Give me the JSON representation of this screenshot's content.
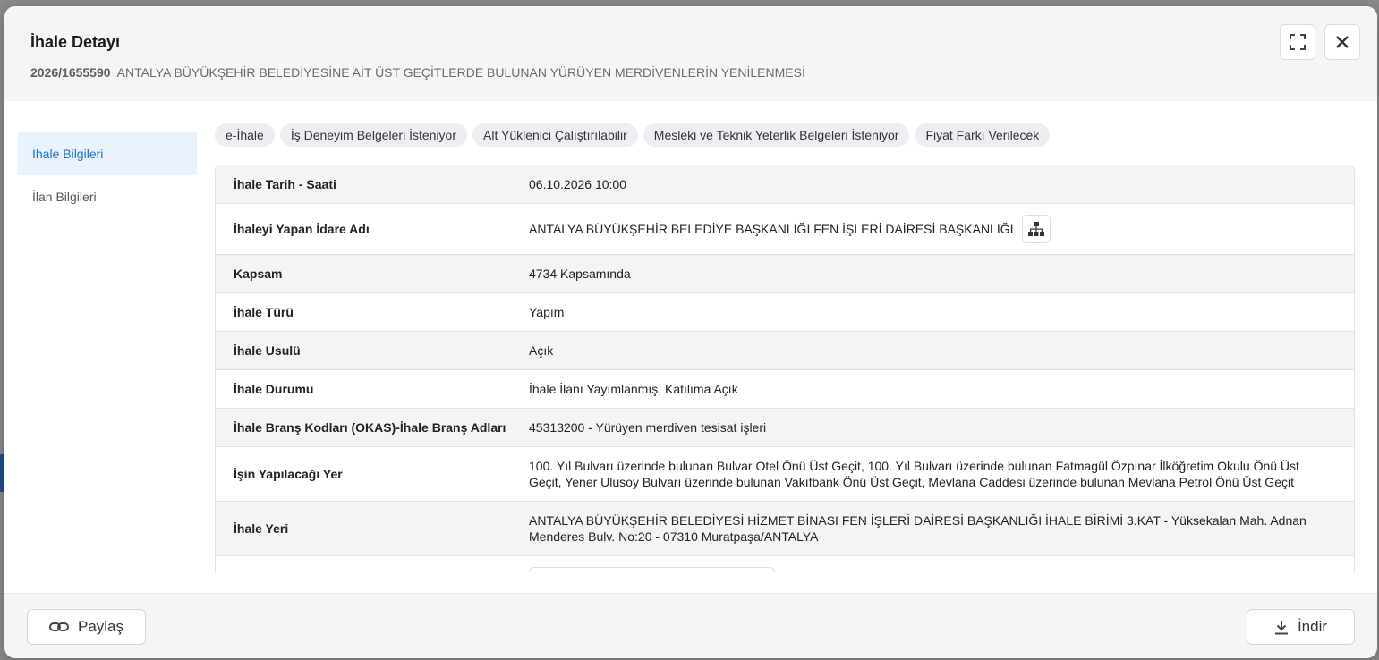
{
  "modal": {
    "title": "İhale Detayı",
    "ref_no": "2026/1655590",
    "subtitle": "ANTALYA BÜYÜKŞEHİR BELEDİYESİNE AİT ÜST GEÇİTLERDE BULUNAN YÜRÜYEN MERDİVENLERİN YENİLENMESİ",
    "expand_icon": "fullscreen-icon",
    "close_icon": "close-icon"
  },
  "sidebar": {
    "items": [
      {
        "label": "İhale Bilgileri",
        "active": true
      },
      {
        "label": "İlan Bilgileri",
        "active": false
      }
    ]
  },
  "chips": [
    "e-İhale",
    "İş Deneyim Belgeleri İsteniyor",
    "Alt Yüklenici Çalıştırılabilir",
    "Mesleki ve Teknik Yeterlik Belgeleri İsteniyor",
    "Fiyat Farkı Verilecek"
  ],
  "details": [
    {
      "label": "İhale Tarih - Saati",
      "value": "06.10.2026 10:00"
    },
    {
      "label": "İhaleyi Yapan İdare Adı",
      "value": "ANTALYA BÜYÜKŞEHİR BELEDİYE BAŞKANLIĞI FEN İŞLERİ DAİRESİ BAŞKANLIĞI"
    },
    {
      "label": "Kapsam",
      "value": "4734 Kapsamında"
    },
    {
      "label": "İhale Türü",
      "value": "Yapım"
    },
    {
      "label": "İhale Usulü",
      "value": "Açık"
    },
    {
      "label": "İhale Durumu",
      "value": "İhale İlanı Yayımlanmış, Katılıma Açık"
    },
    {
      "label": "İhale Branş Kodları (OKAS)-İhale Branş Adları",
      "value": "45313200 - Yürüyen merdiven tesisat işleri"
    },
    {
      "label": "İşin Yapılacağı Yer",
      "value": "100. Yıl Bulvarı üzerinde bulunan Bulvar Otel Önü Üst Geçit, 100. Yıl Bulvarı üzerinde bulunan Fatmagül Özpınar İlköğretim Okulu Önü Üst Geçit, Yener Ulusoy Bulvarı üzerinde bulunan Vakıfbank Önü Üst Geçit, Mevlana Caddesi üzerinde bulunan Mevlana Petrol Önü Üst Geçit"
    },
    {
      "label": "İhale Yeri",
      "value": "ANTALYA BÜYÜKŞEHİR BELEDİYESİ HİZMET BİNASI FEN İŞLERİ DAİRESİ BAŞKANLIĞI İHALE BİRİMİ 3.KAT - Yüksekalan Mah. Adnan Menderes Bulv. No:20 - 07310 Muratpaşa/ANTALYA"
    }
  ],
  "footer": {
    "share_label": "Paylaş",
    "download_label": "İndir"
  }
}
